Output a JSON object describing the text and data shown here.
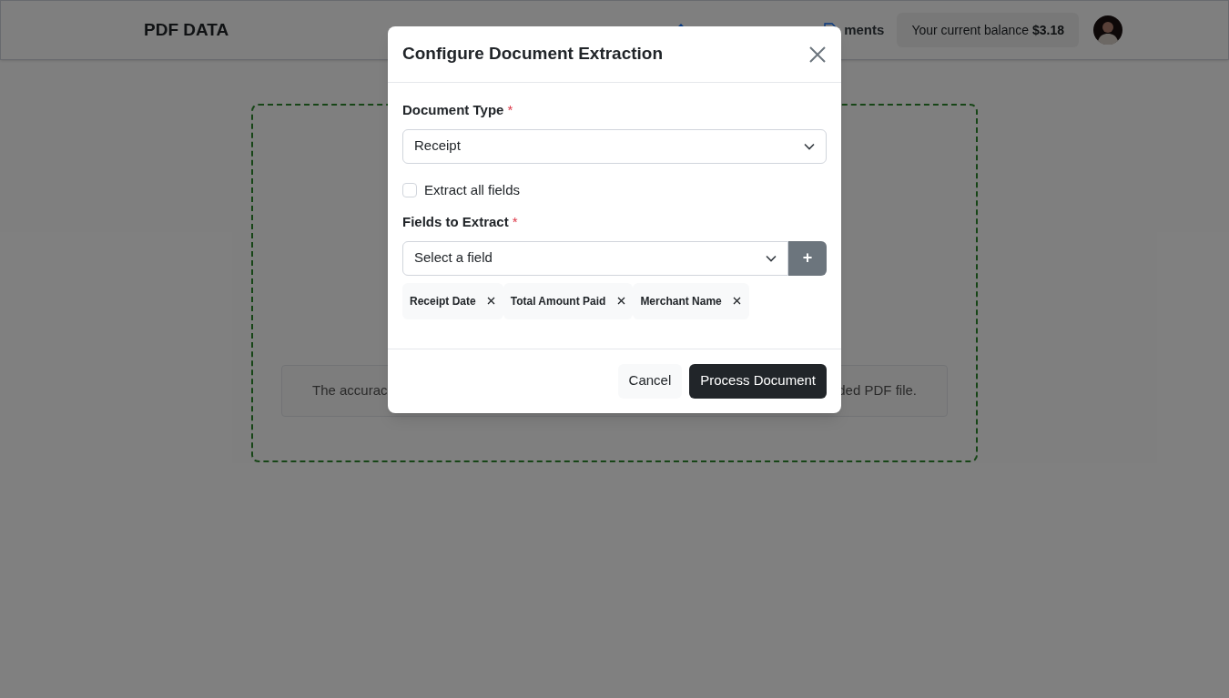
{
  "header": {
    "logo": "PDF DATA",
    "nav_links": [
      {
        "kind": "upload"
      },
      {
        "kind": "document",
        "text": "ments"
      }
    ],
    "balance": {
      "label": "Your current balance",
      "amount": "$3.18"
    }
  },
  "upload_area": {
    "notice_left": "The accurac",
    "notice_right": "ded PDF file."
  },
  "dialog": {
    "title": "Configure Document Extraction",
    "document_type": {
      "label": "Document Type",
      "required_mark": "*",
      "value": "Receipt"
    },
    "extract_all": {
      "label": "Extract all fields",
      "checked": false
    },
    "fields": {
      "label": "Fields to Extract",
      "required_mark": "*",
      "placeholder": "Select a field",
      "add_button": "+",
      "chips": [
        {
          "label": "Receipt Date"
        },
        {
          "label": "Total Amount Paid"
        },
        {
          "label": "Merchant Name"
        }
      ]
    },
    "buttons": [
      {
        "label": "Cancel",
        "kind": "secondary"
      },
      {
        "label": "Process Document",
        "kind": "primary"
      }
    ]
  }
}
